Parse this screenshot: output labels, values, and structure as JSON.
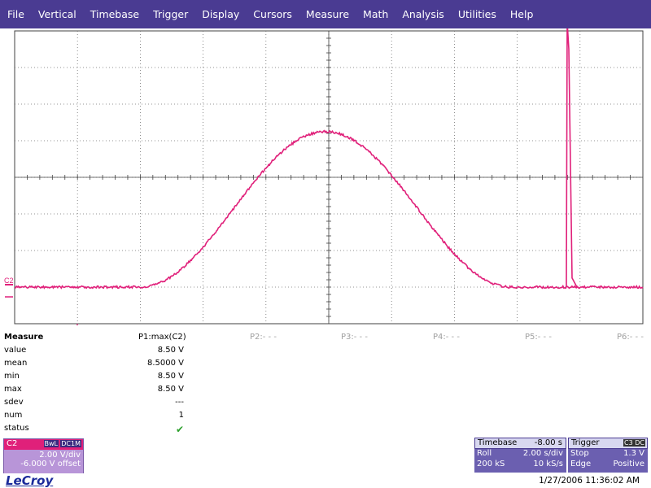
{
  "menu": [
    "File",
    "Vertical",
    "Timebase",
    "Trigger",
    "Display",
    "Cursors",
    "Measure",
    "Math",
    "Analysis",
    "Utilities",
    "Help"
  ],
  "colors": {
    "menubar": "#4a3b92",
    "trace": "#e0207a",
    "grid": "#606060"
  },
  "trace": {
    "label": "C2"
  },
  "waveform": {
    "description_values_volts": {
      "baseline": -6.0,
      "peak_hump": 2.5,
      "spike_peak": 8.5
    },
    "x_range_s": [
      -10,
      10
    ],
    "y_range_V": [
      -8,
      8
    ]
  },
  "measure": {
    "title": "Measure",
    "rows": [
      {
        "label": "value",
        "value": "8.50 V"
      },
      {
        "label": "mean",
        "value": "8.5000 V"
      },
      {
        "label": "min",
        "value": "8.50 V"
      },
      {
        "label": "max",
        "value": "8.50 V"
      },
      {
        "label": "sdev",
        "value": "---"
      },
      {
        "label": "num",
        "value": "1"
      },
      {
        "label": "status",
        "value": "✔"
      }
    ],
    "params": [
      "P1:max(C2)",
      "P2:- - -",
      "P3:- - -",
      "P4:- - -",
      "P5:- - -",
      "P6:- - -"
    ]
  },
  "channel_box": {
    "name": "C2",
    "tags": [
      "BwL",
      "DC1M"
    ],
    "vdiv": "2.00 V/div",
    "offset": "-6.000 V offset"
  },
  "timebase_box": {
    "title": "Timebase",
    "title_value": "-8.00 s",
    "mode": "Roll",
    "sdiv": "2.00 s/div",
    "samples": "200 kS",
    "rate": "10 kS/s"
  },
  "trigger_box": {
    "title": "Trigger",
    "badge": "C3 DC",
    "state": "Stop",
    "level": "1.3 V",
    "type": "Edge",
    "slope": "Positive"
  },
  "footer": {
    "logo": "LeCroy",
    "datetime": "1/27/2006 11:36:02 AM"
  }
}
